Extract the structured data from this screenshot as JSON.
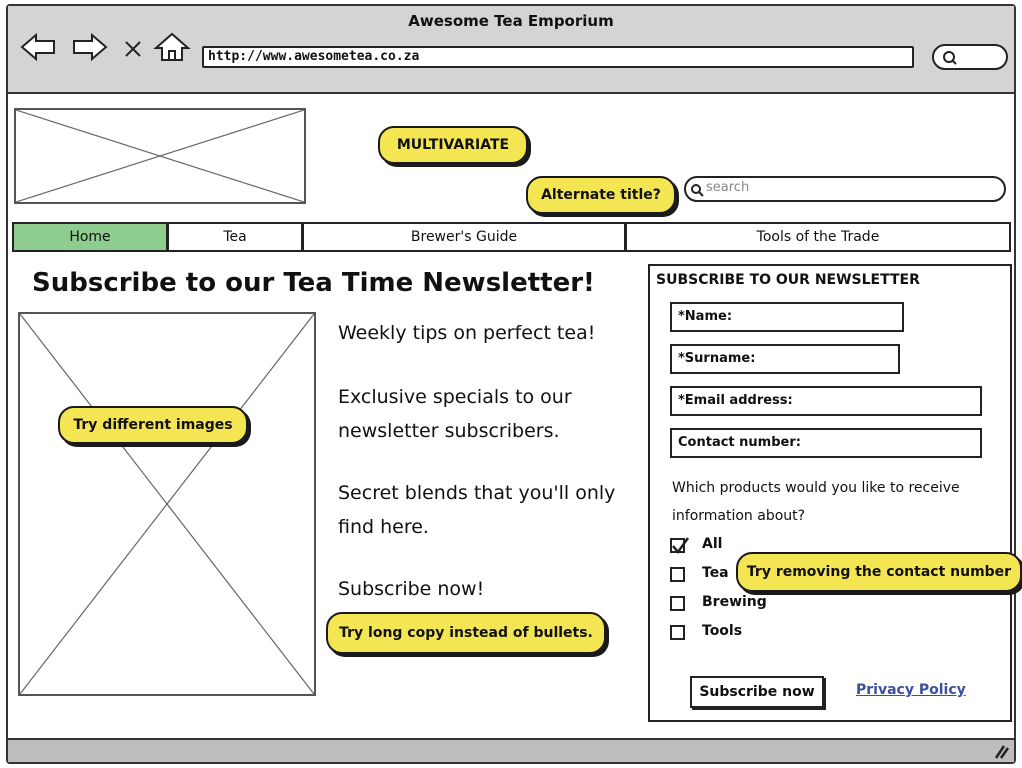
{
  "window": {
    "title": "Awesome Tea Emporium"
  },
  "toolbar": {
    "url": "http://www.awesometea.co.za",
    "icons": [
      "back-arrow-icon",
      "forward-arrow-icon",
      "close-x-icon",
      "home-icon",
      "search-icon"
    ]
  },
  "header": {
    "search_placeholder": "search",
    "notes": {
      "multivariate": "MULTIVARIATE",
      "alternate_title": "Alternate title?"
    }
  },
  "nav": {
    "items": [
      {
        "label": "Home",
        "active": true
      },
      {
        "label": "Tea"
      },
      {
        "label": "Brewer's Guide"
      },
      {
        "label": "Tools of the Trade"
      }
    ],
    "active_color": "#8fcc8f"
  },
  "main": {
    "headline": "Subscribe to our Tea Time Newsletter!",
    "image_note": "Try different images",
    "bullets": [
      "Weekly tips on perfect tea!",
      "Exclusive specials to our newsletter subscribers.",
      "Secret blends that you'll only find here.",
      "Subscribe now!"
    ],
    "copy_note": "Try long copy instead of bullets."
  },
  "newsletter": {
    "title": "SUBSCRIBE TO OUR NEWSLETTER",
    "fields": {
      "name": "*Name:",
      "surname": "*Surname:",
      "email": "*Email address:",
      "contact": "Contact number:"
    },
    "question": "Which products would you like to receive information about?",
    "options": [
      {
        "label": "All",
        "checked": true
      },
      {
        "label": "Tea",
        "checked": false
      },
      {
        "label": "Brewing",
        "checked": false
      },
      {
        "label": "Tools",
        "checked": false
      }
    ],
    "contact_note": "Try removing the contact number",
    "subscribe_label": "Subscribe now",
    "privacy_label": "Privacy Policy"
  },
  "colors": {
    "note_yellow": "#f4e652",
    "link_blue": "#3c4fa0",
    "chrome_gray": "#d4d4d4"
  }
}
